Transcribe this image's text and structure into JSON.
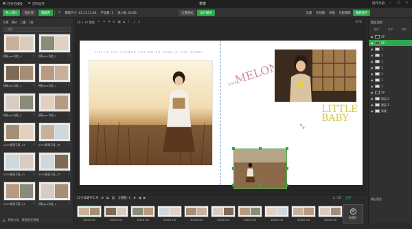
{
  "titlebar": {
    "menu": [
      "任务栏模版",
      "定制选项"
    ],
    "title": "季季",
    "right": [
      "操作手册"
    ],
    "window_buttons": [
      "minimize-icon",
      "maximize-icon",
      "close-icon"
    ]
  },
  "toolbar": {
    "items": [
      "导入照片",
      "照片库",
      "模版库"
    ],
    "info": [
      "模板尺寸: 05.11 11:44",
      "产品数: 2",
      "进入数: 01/01"
    ],
    "mode_buttons": [
      "全景模式",
      "设计模式"
    ],
    "right": [
      "云盘",
      "在线版",
      "扫描",
      "已配模板",
      "模板保存"
    ]
  },
  "left_panel": {
    "tabs": [
      "写真",
      "婚纱",
      "儿童",
      "3张"
    ],
    "search_placeholder": "搜索",
    "thumbs": [
      {
        "label": "模板pns功能_4"
      },
      {
        "label": "模板pns功能_3"
      },
      {
        "label": "模板pns功能_2"
      },
      {
        "label": "模板pns功能_1"
      },
      {
        "label": "模板pns功能_5"
      },
      {
        "label": "模板pns功能_4"
      },
      {
        "label": "2020模板写真_44"
      },
      {
        "label": "2020模板写真_36"
      },
      {
        "label": "2020模板写真_22"
      },
      {
        "label": "2020模板写真_29"
      },
      {
        "label": "2020模板写真_21"
      },
      {
        "label": "模板pns功能_4"
      }
    ],
    "bottom": [
      "模板分类",
      "模板版型/模板"
    ]
  },
  "canvas": {
    "top_label": "20 x 10 模板",
    "zoom": "65%",
    "love_text": "LIFE IS THE FLOWER FOR WHICH LOVE IS THE HONEY",
    "melon_text": "MELON MOJITO",
    "baby_text": "LITTLE BABY"
  },
  "right_panel": {
    "header": "图层面板",
    "tools": [
      "图片",
      "文字",
      "对齐"
    ],
    "layers": [
      {
        "name": "5P",
        "type": "dark"
      },
      {
        "name": "5P",
        "type": "pic",
        "active": true
      },
      {
        "name": "1",
        "type": "light"
      },
      {
        "name": "1",
        "type": "light"
      },
      {
        "name": "1",
        "type": "light"
      },
      {
        "name": "1",
        "type": "light"
      },
      {
        "name": "1",
        "type": "light"
      },
      {
        "name": "1",
        "type": "light"
      },
      {
        "name": "1",
        "type": "light"
      },
      {
        "name": "5P",
        "type": "dark"
      },
      {
        "name": "图层 2",
        "type": "light"
      },
      {
        "name": "图层 1",
        "type": "light"
      },
      {
        "name": "背景",
        "type": "light"
      }
    ],
    "bottom": "输出预览"
  },
  "bottom_bar": {
    "title": "12寸高端手工书",
    "counter": "全图数: 1",
    "page_indicator": "2 / 10",
    "group": "全部",
    "pages": [
      {
        "label": "20x10 cm"
      },
      {
        "label": "20x10 cm"
      },
      {
        "label": "20x10 cm"
      },
      {
        "label": "20x10 cm"
      },
      {
        "label": "20x10 cm"
      },
      {
        "label": "20x10 cm"
      },
      {
        "label": "20x10 cm"
      },
      {
        "label": "20x10 cm"
      },
      {
        "label": "20x10 cm"
      },
      {
        "label": "20x10 cm"
      }
    ],
    "add_label": "新建页"
  }
}
